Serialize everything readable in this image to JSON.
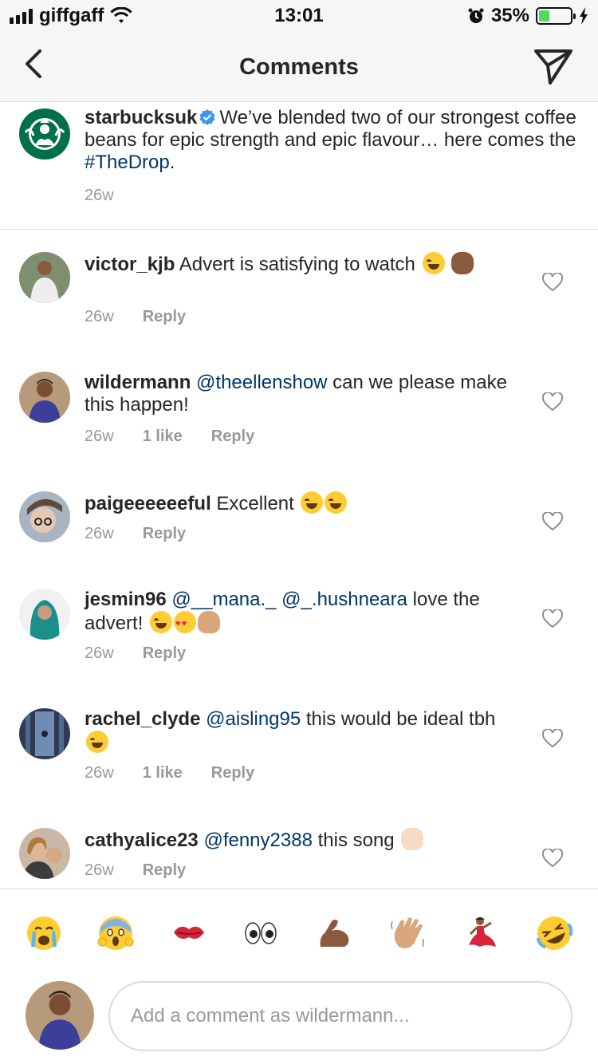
{
  "status_bar": {
    "carrier": "giffgaff",
    "time": "13:01",
    "battery_percent": "35%",
    "battery_level": 0.35
  },
  "nav": {
    "title": "Comments"
  },
  "caption": {
    "username": "starbucksuk",
    "text_before": "We’ve blended two of our strongest coffee beans for epic strength and epic flavour… here comes the ",
    "hashtag": "#TheDrop",
    "text_after": ".",
    "age": "26w"
  },
  "comments": [
    {
      "username": "victor_kjb",
      "text": "Advert is satisfying to watch",
      "age": "26w",
      "likes": "",
      "reply": "Reply"
    },
    {
      "username": "wildermann",
      "mention": "@theellenshow",
      "text": "can we please make this happen!",
      "age": "26w",
      "likes": "1 like",
      "reply": "Reply"
    },
    {
      "username": "paigeeeeeeful",
      "text": "Excellent",
      "age": "26w",
      "likes": "",
      "reply": "Reply"
    },
    {
      "username": "jesmin96",
      "mention": "@__mana._ @_.hushneara",
      "text": "love the advert!",
      "age": "26w",
      "likes": "",
      "reply": "Reply"
    },
    {
      "username": "rachel_clyde",
      "mention": "@aisling95",
      "text": "this would be ideal tbh",
      "age": "26w",
      "likes": "1 like",
      "reply": "Reply"
    },
    {
      "username": "cathyalice23",
      "mention": "@fenny2388",
      "text": "this song",
      "age": "26w",
      "likes": "",
      "reply": "Reply"
    }
  ],
  "emoji_bar": [
    "crying-face",
    "screaming-face",
    "kiss-mark",
    "eyes",
    "flexed-biceps",
    "waving-hand",
    "dancer",
    "rolling-laughing-face"
  ],
  "compose": {
    "placeholder": "Add a comment as wildermann..."
  },
  "colors": {
    "link": "#003569",
    "verified": "#3897f0",
    "muted": "#999999",
    "starbucks_green": "#00704a"
  }
}
